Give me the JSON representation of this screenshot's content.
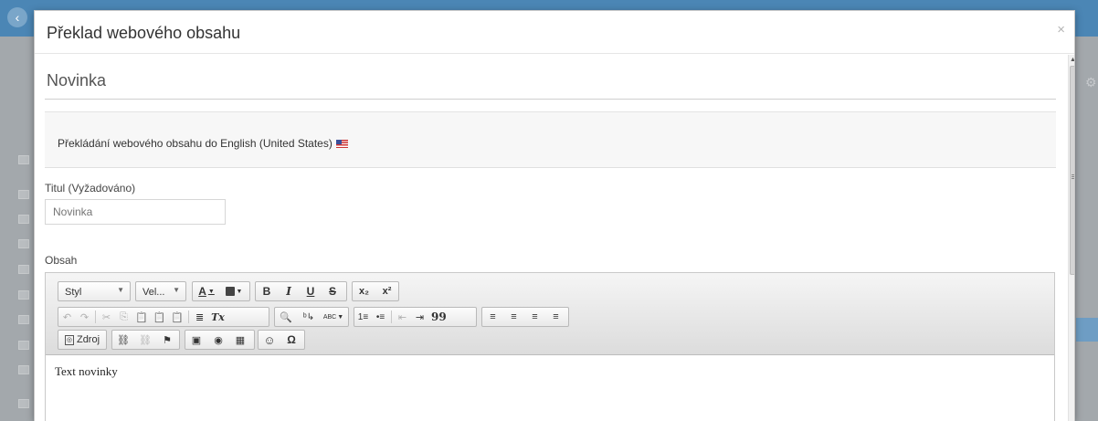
{
  "dialog": {
    "title": "Překlad webového obsahu",
    "close_glyph": "×"
  },
  "section": {
    "title": "Novinka"
  },
  "info": {
    "text": "Překládání webového obsahu do English (United States)",
    "flag_icon": "us-flag-icon"
  },
  "form": {
    "title_label": "Titul (Vyžadováno)",
    "title_placeholder": "Novinka",
    "content_label": "Obsah"
  },
  "editor": {
    "style_combo": "Styl",
    "size_combo": "Vel...",
    "source_button": "Zdroj",
    "content_text": "Text novinky",
    "glyphs": {
      "text_color": "A",
      "bold": "B",
      "italic": "I",
      "underline": "U",
      "strike": "S",
      "subscript": "x₂",
      "superscript": "x²",
      "undo": "↶",
      "redo": "↷",
      "cut": "✂",
      "copy": "⎘",
      "paste": "📋",
      "paste_text": "📋",
      "paste_word": "📋",
      "align_block": "≣",
      "remove_format": "Tx",
      "find": "🔍",
      "replace": "ᵇ↳",
      "spellcheck": "ABC",
      "ordered_list": "1≡",
      "bullet_list": "•≡",
      "outdent": "⇤",
      "indent": "⇥",
      "blockquote": "99",
      "align_left": "≡",
      "align_center": "≡",
      "align_right": "≡",
      "align_justify": "≡",
      "link": "⛓",
      "unlink": "⛓",
      "anchor": "⚑",
      "image": "▣",
      "flash": "◉",
      "table": "▦",
      "smiley": "☺",
      "special_char": "Ω"
    }
  }
}
